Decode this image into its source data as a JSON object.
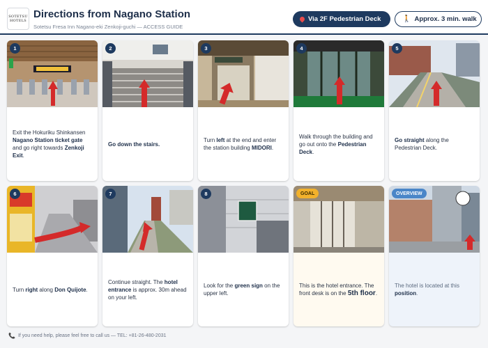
{
  "header": {
    "logo_line1": "SOTETSU",
    "logo_line2": "HOTELS",
    "title": "Directions from Nagano Station",
    "subtitle": "Sotetsu Fresa Inn Nagano-eki Zenkoji-guchi — ACCESS GUIDE",
    "route_pill": "Via 2F Pedestrian Deck",
    "time_pill": "Approx. 3 min. walk"
  },
  "steps": [
    {
      "badge": "1",
      "icon": "photo-ticket-gate",
      "text": [
        {
          "t": "Exit the Hokuriku Shinkansen "
        },
        {
          "t": "Nagano Station ticket gate",
          "b": true
        },
        {
          "t": " and go right towards "
        },
        {
          "t": "Zenkoji Exit",
          "b": true
        },
        {
          "t": "."
        }
      ]
    },
    {
      "badge": "2",
      "icon": "photo-stairs",
      "text": [
        {
          "t": "Go down the stairs.",
          "b": true
        }
      ]
    },
    {
      "badge": "3",
      "icon": "photo-midori-entrance",
      "text": [
        {
          "t": "Turn "
        },
        {
          "t": "left",
          "b": true
        },
        {
          "t": " at the end and enter the station building "
        },
        {
          "t": "MIDORI",
          "b": true
        },
        {
          "t": "."
        }
      ]
    },
    {
      "badge": "4",
      "icon": "photo-midori-doors",
      "text": [
        {
          "t": "Walk through the building and go out onto the "
        },
        {
          "t": "Pedestrian Deck",
          "b": true
        },
        {
          "t": "."
        }
      ]
    },
    {
      "badge": "5",
      "icon": "photo-pedestrian-deck",
      "text": [
        {
          "t": "Go straight",
          "b": true
        },
        {
          "t": " along the Pedestrian Deck."
        }
      ]
    },
    {
      "badge": "6",
      "icon": "photo-don-quijote",
      "text": [
        {
          "t": "Turn "
        },
        {
          "t": "right",
          "b": true
        },
        {
          "t": " along "
        },
        {
          "t": "Don Quijote",
          "b": true
        },
        {
          "t": "."
        }
      ]
    },
    {
      "badge": "7",
      "icon": "photo-walkway",
      "text": [
        {
          "t": "Continue straight. The "
        },
        {
          "t": "hotel entrance",
          "b": true
        },
        {
          "t": " is approx. 30m ahead on your left."
        }
      ]
    },
    {
      "badge": "8",
      "icon": "photo-green-sign",
      "text": [
        {
          "t": "Look for the "
        },
        {
          "t": "green sign",
          "b": true
        },
        {
          "t": " on the upper left."
        }
      ]
    },
    {
      "badge": "GOAL",
      "icon": "photo-hotel-entrance",
      "text": [
        {
          "t": "This is the hotel entrance. The front desk is on the "
        },
        {
          "t": "5th floor",
          "b": true,
          "big": true
        },
        {
          "t": "."
        }
      ]
    },
    {
      "badge": "OVERVIEW",
      "icon": "photo-street-overview",
      "text": [
        {
          "t": "The hotel is located at this "
        },
        {
          "t": "position",
          "b": true
        },
        {
          "t": "."
        }
      ]
    }
  ],
  "footer": {
    "text": "If you need help, please feel free to call us — TEL: +81-26-480-2031"
  },
  "colors": {
    "navy": "#1e3a5f",
    "arrow_red": "#d42a2a",
    "goal_yellow": "#f2b12c",
    "overview_blue": "#4a86c8"
  }
}
